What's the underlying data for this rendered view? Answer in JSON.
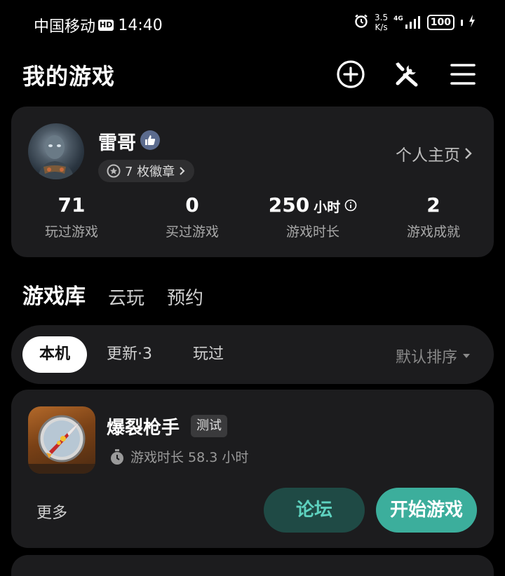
{
  "status_bar": {
    "carrier": "中国移动",
    "hd": "HD",
    "time": "14:40",
    "net_speed_value": "3.5",
    "net_speed_unit": "K/s",
    "network": "4G",
    "battery": "100"
  },
  "header": {
    "title": "我的游戏"
  },
  "profile": {
    "username": "雷哥",
    "badges_label": "7 枚徽章",
    "profile_link": "个人主页",
    "stats": [
      {
        "value": "71",
        "unit": "",
        "label": "玩过游戏"
      },
      {
        "value": "0",
        "unit": "",
        "label": "买过游戏"
      },
      {
        "value": "250",
        "unit": "小时",
        "label": "游戏时长"
      },
      {
        "value": "2",
        "unit": "",
        "label": "游戏成就"
      }
    ]
  },
  "main_tabs": [
    "游戏库",
    "云玩",
    "预约"
  ],
  "sub_tabs": [
    "本机",
    "更新·3",
    "玩过"
  ],
  "sort_label": "默认排序",
  "game": {
    "title": "爆裂枪手",
    "tag": "测试",
    "playtime": "游戏时长 58.3 小时",
    "more_label": "更多",
    "forum_label": "论坛",
    "start_label": "开始游戏"
  },
  "colors": {
    "accent": "#3cae9c",
    "card_bg": "#1c1c1e",
    "background": "#000000"
  }
}
